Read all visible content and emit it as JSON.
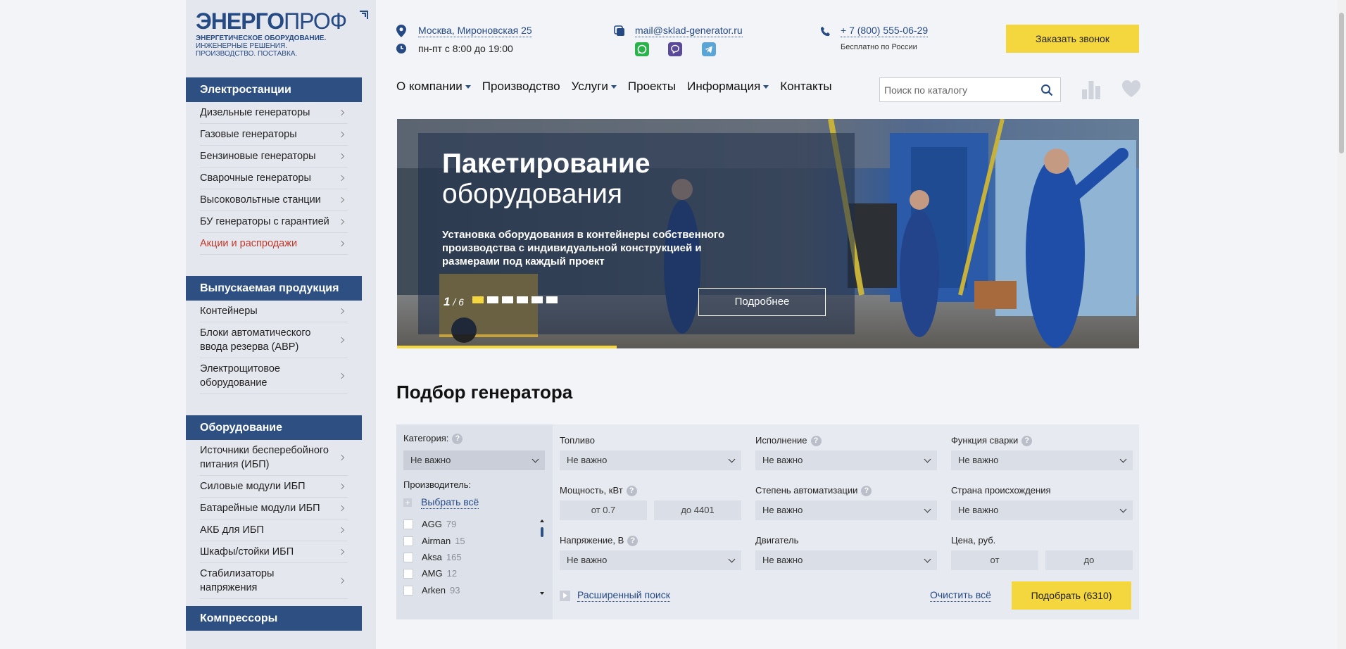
{
  "logo": {
    "name_bold": "ЭНЕРГО",
    "name_light": "ПРОФ",
    "tagline": [
      "ЭНЕРГЕТИЧЕСКОЕ ОБОРУДОВАНИЕ.",
      "ИНЖЕНЕРНЫЕ РЕШЕНИЯ.",
      "ПРОИЗВОДСТВО. ПОСТАВКА."
    ]
  },
  "sidebar": {
    "sections": [
      {
        "title": "Электростанции",
        "items": [
          "Дизельные генераторы",
          "Газовые генераторы",
          "Бензиновые генераторы",
          "Сварочные генераторы",
          "Высоковольтные станции",
          "БУ генераторы с гарантией",
          "Акции и распродажи"
        ]
      },
      {
        "title": "Выпускаемая продукция",
        "items": [
          "Контейнеры",
          "Блоки автоматического ввода резерва (АВР)",
          "Электрощитовое оборудование"
        ]
      },
      {
        "title": "Оборудование",
        "items": [
          "Источники бесперебойного питания (ИБП)",
          "Силовые модули ИБП",
          "Батарейные модули ИБП",
          "АКБ для ИБП",
          "Шкафы/стойки ИБП",
          "Стабилизаторы напряжения"
        ]
      },
      {
        "title": "Компрессоры",
        "items": []
      }
    ]
  },
  "header": {
    "address": "Москва, Мироновская 25",
    "hours": "пн-пт с 8:00 до 19:00",
    "email": "mail@sklad-generator.ru",
    "phone": "+ 7 (800) 555-06-29",
    "phone_note": "Бесплатно по России",
    "call_button": "Заказать звонок",
    "messengers": [
      "whatsapp-icon",
      "viber-icon",
      "telegram-icon"
    ]
  },
  "nav": {
    "items": [
      {
        "label": "О компании",
        "dropdown": true
      },
      {
        "label": "Производство",
        "dropdown": false
      },
      {
        "label": "Услуги",
        "dropdown": true
      },
      {
        "label": "Проекты",
        "dropdown": false
      },
      {
        "label": "Информация",
        "dropdown": true
      },
      {
        "label": "Контакты",
        "dropdown": false
      }
    ],
    "search_placeholder": "Поиск по каталогу"
  },
  "banner": {
    "title_bold": "Пакетирование",
    "title_light": "оборудования",
    "description": "Установка оборудования в контейнеры собственного производства с индивидуальной конструкцией и размерами под каждый проект",
    "slide_current": "1",
    "slide_total": "/ 6",
    "active_slide": 1,
    "slide_count": 6,
    "more_button": "Подробнее"
  },
  "selector": {
    "title": "Подбор генератора",
    "category_label": "Категория:",
    "category_value": "Не важно",
    "manufacturer_label": "Производитель:",
    "select_all": "Выбрать всё",
    "manufacturers": [
      {
        "name": "AGG",
        "count": "79"
      },
      {
        "name": "Airman",
        "count": "15"
      },
      {
        "name": "Aksa",
        "count": "165"
      },
      {
        "name": "AMG",
        "count": "12"
      },
      {
        "name": "Arken",
        "count": "93"
      }
    ],
    "fuel_label": "Топливо",
    "fuel_value": "Не важно",
    "design_label": "Исполнение",
    "design_value": "Не важно",
    "welding_label": "Функция сварки",
    "welding_value": "Не важно",
    "power_label": "Мощность, кВт",
    "power_from": "от 0.7",
    "power_to": "до 4401",
    "automation_label": "Степень автоматизации",
    "automation_value": "Не важно",
    "country_label": "Страна происхождения",
    "country_value": "Не важно",
    "voltage_label": "Напряжение, В",
    "voltage_value": "Не важно",
    "engine_label": "Двигатель",
    "engine_value": "Не важно",
    "price_label": "Цена, руб.",
    "price_from": "от",
    "price_to": "до",
    "advanced": "Расширенный поиск",
    "clear": "Очистить всё",
    "submit": "Подобрать (6310)"
  },
  "colors": {
    "brand_blue": "#2d4f82",
    "accent_yellow": "#f4d63f",
    "link_blue": "#254a84",
    "sale_red": "#c0392b"
  }
}
